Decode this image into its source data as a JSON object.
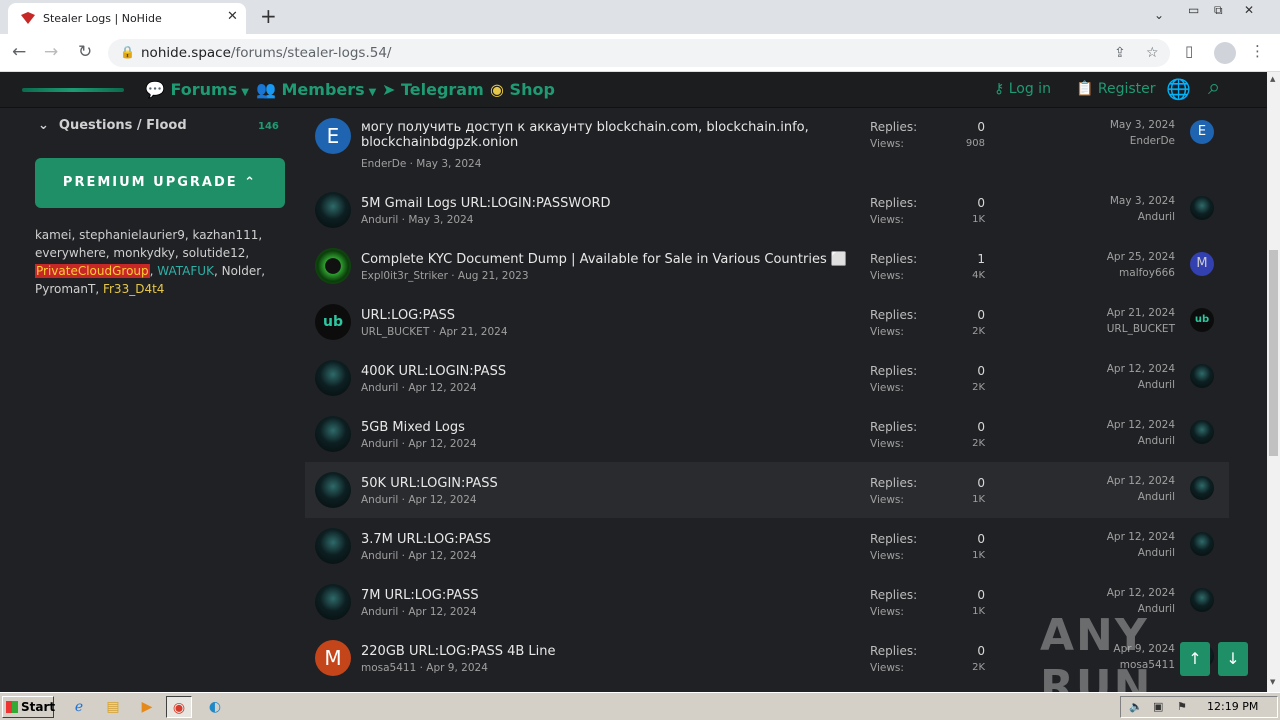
{
  "browser": {
    "tab_title": "Stealer Logs | NoHide",
    "url_host": "nohide.space",
    "url_path": "/forums/stealer-logs.54/"
  },
  "nav": {
    "forums": "Forums",
    "members": "Members",
    "telegram": "Telegram",
    "shop": "Shop",
    "login": "Log in",
    "register": "Register"
  },
  "sidebar": {
    "questions_label": "Questions / Flood",
    "questions_count": "146",
    "premium": "PREMIUM UPGRADE",
    "online_users": [
      "kamei",
      "stephanielaurier9",
      "kazhan111",
      "everywhere",
      "monkydky",
      "solutide12",
      "PrivateCloudGroup",
      "WATAFUK",
      "Nolder",
      "PyromanT",
      "Fr33_D4t4"
    ]
  },
  "labels": {
    "replies": "Replies:",
    "views": "Views:"
  },
  "threads": [
    {
      "title": "могу получить доступ к аккаунту blockchain.com, blockchain.info,",
      "title2": "blockchainbdgpzk.onion",
      "author": "EnderDe",
      "date": "May 3, 2024",
      "replies": "0",
      "views": "908",
      "last_date": "May 3, 2024",
      "last_user": "EnderDe",
      "avatar": "E",
      "av_class": "av-e",
      "sav_text": "E",
      "sav_class": "av-e"
    },
    {
      "title": "5M Gmail Logs URL:LOGIN:PASSWORD",
      "author": "Anduril",
      "date": "May 3, 2024",
      "replies": "0",
      "views": "1K",
      "last_date": "May 3, 2024",
      "last_user": "Anduril",
      "avatar": "",
      "av_class": "av-dark",
      "sav_text": "",
      "sav_class": "av-dark"
    },
    {
      "title": "Complete KYC Document Dump | Available for Sale in Various Countries ⬜",
      "author": "Expl0it3r_Striker",
      "date": "Aug 21, 2023",
      "replies": "1",
      "views": "4K",
      "last_date": "Apr 25, 2024",
      "last_user": "malfoy666",
      "avatar": "",
      "av_class": "av-green",
      "sav_text": "M",
      "sav_class": "av-m2"
    },
    {
      "title": "URL:LOG:PASS",
      "author": "URL_BUCKET",
      "date": "Apr 21, 2024",
      "replies": "0",
      "views": "2K",
      "last_date": "Apr 21, 2024",
      "last_user": "URL_BUCKET",
      "avatar": "ub",
      "av_class": "av-ub",
      "sav_text": "ub",
      "sav_class": "av-ub"
    },
    {
      "title": "400K URL:LOGIN:PASS",
      "author": "Anduril",
      "date": "Apr 12, 2024",
      "replies": "0",
      "views": "2K",
      "last_date": "Apr 12, 2024",
      "last_user": "Anduril",
      "avatar": "",
      "av_class": "av-dark",
      "sav_text": "",
      "sav_class": "av-dark"
    },
    {
      "title": "5GB Mixed Logs",
      "author": "Anduril",
      "date": "Apr 12, 2024",
      "replies": "0",
      "views": "2K",
      "last_date": "Apr 12, 2024",
      "last_user": "Anduril",
      "avatar": "",
      "av_class": "av-dark",
      "sav_text": "",
      "sav_class": "av-dark"
    },
    {
      "title": "50K URL:LOGIN:PASS",
      "author": "Anduril",
      "date": "Apr 12, 2024",
      "replies": "0",
      "views": "1K",
      "last_date": "Apr 12, 2024",
      "last_user": "Anduril",
      "avatar": "",
      "av_class": "av-dark",
      "sav_text": "",
      "sav_class": "av-dark"
    },
    {
      "title": "3.7M URL:LOG:PASS",
      "author": "Anduril",
      "date": "Apr 12, 2024",
      "replies": "0",
      "views": "1K",
      "last_date": "Apr 12, 2024",
      "last_user": "Anduril",
      "avatar": "",
      "av_class": "av-dark",
      "sav_text": "",
      "sav_class": "av-dark"
    },
    {
      "title": "7M URL:LOG:PASS",
      "author": "Anduril",
      "date": "Apr 12, 2024",
      "replies": "0",
      "views": "1K",
      "last_date": "Apr 12, 2024",
      "last_user": "Anduril",
      "avatar": "",
      "av_class": "av-dark",
      "sav_text": "",
      "sav_class": "av-dark"
    },
    {
      "title": "220GB URL:LOG:PASS 4B Line",
      "author": "mosa5411",
      "date": "Apr 9, 2024",
      "replies": "0",
      "views": "2K",
      "last_date": "Apr 9, 2024",
      "last_user": "mosa5411",
      "avatar": "M",
      "av_class": "av-m",
      "sav_text": "",
      "sav_class": "av-dark"
    }
  ],
  "watermark": "ANY RUN",
  "taskbar": {
    "start": "Start",
    "clock": "12:19 PM"
  },
  "colors": {
    "accent": "#1f9b73",
    "premium_bg": "#1f8f67",
    "page_bg": "#202124"
  }
}
